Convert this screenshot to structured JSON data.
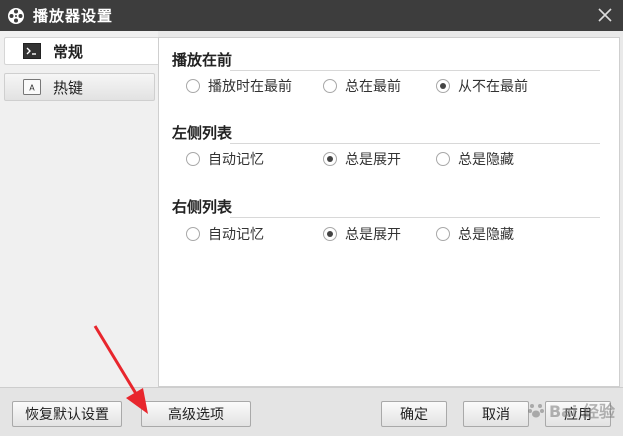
{
  "window": {
    "title": "播放器设置"
  },
  "sidebar": {
    "items": [
      {
        "label": "常规",
        "icon": "terminal-icon",
        "active": true
      },
      {
        "label": "热键",
        "icon": "keyboard-key-icon",
        "active": false
      }
    ]
  },
  "groups": [
    {
      "title": "播放在前",
      "options": [
        "播放时在最前",
        "总在最前",
        "从不在最前"
      ],
      "selected": 2
    },
    {
      "title": "左侧列表",
      "options": [
        "自动记忆",
        "总是展开",
        "总是隐藏"
      ],
      "selected": 1
    },
    {
      "title": "右侧列表",
      "options": [
        "自动记忆",
        "总是展开",
        "总是隐藏"
      ],
      "selected": 1
    }
  ],
  "footer": {
    "restore_label": "恢复默认设置",
    "advanced_label": "高级选项",
    "ok_label": "确定",
    "cancel_label": "取消",
    "apply_label": "应用"
  },
  "watermark": {
    "text": "Bai 经验"
  },
  "colors": {
    "titlebar": "#3d3d3d",
    "arrow": "#e8262d"
  }
}
